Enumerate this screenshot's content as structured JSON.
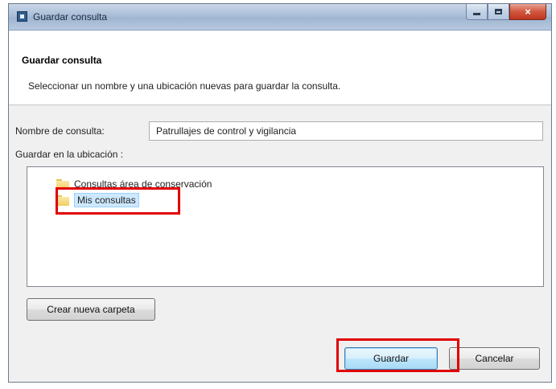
{
  "window": {
    "title": "Guardar consulta",
    "controls": {
      "minimize": "minimize",
      "maximize": "maximize",
      "close": "×"
    }
  },
  "header": {
    "title": "Guardar consulta",
    "description": "Seleccionar un nombre y una ubicación nuevas para guardar la consulta."
  },
  "form": {
    "name_label": "Nombre de consulta:",
    "name_value": "Patrullajes de control y vigilancia",
    "location_label": "Guardar en la ubicación :"
  },
  "tree": {
    "items": [
      {
        "label": "Consultas área de conservación",
        "icon": "folder-icon",
        "selected": false
      },
      {
        "label": "Mis consultas",
        "icon": "folder-icon",
        "selected": true
      }
    ]
  },
  "buttons": {
    "new_folder": "Crear nueva carpeta",
    "save": "Guardar",
    "cancel": "Cancelar"
  },
  "colors": {
    "highlight": "#e10000",
    "selection": "#cde8ff"
  }
}
